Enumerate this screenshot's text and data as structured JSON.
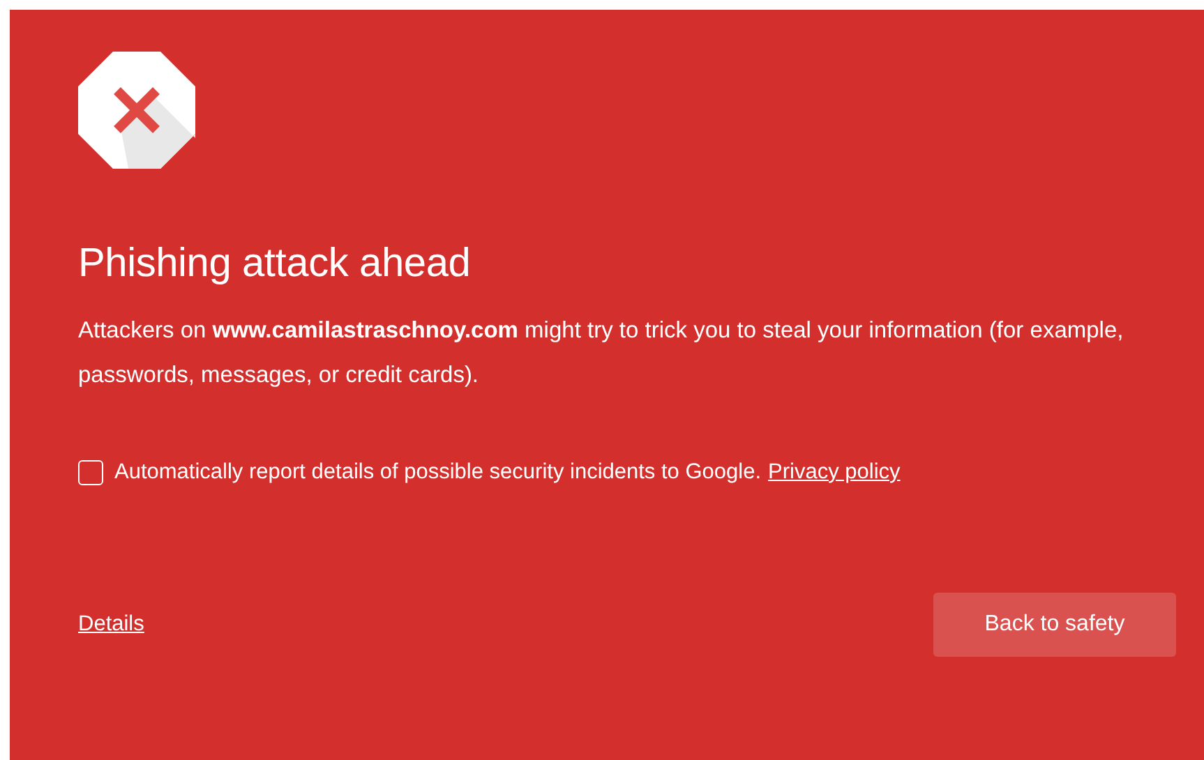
{
  "title": "Phishing attack ahead",
  "message": "Attackers on **www.camilastraschnoy.com** might try to trick you to steal your information (for example, passwords, messages, or credit cards).",
  "report": {
    "label": "Automatically report details of possible security incidents to Google.",
    "checked": false,
    "link": "Privacy policy"
  },
  "details_link": "Details",
  "primary_button": "Back to safety"
}
